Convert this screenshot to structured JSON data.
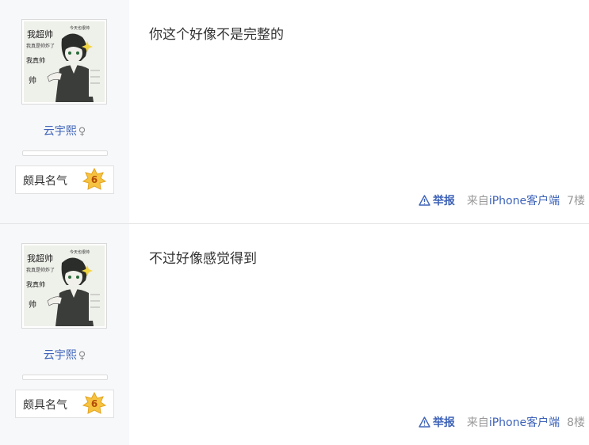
{
  "posts": [
    {
      "author": {
        "name": "云宇熙",
        "gender_symbol": "♀",
        "level_title": "颇具名气",
        "level": "6"
      },
      "content": "你这个好像不是完整的",
      "footer": {
        "report_label": "举报",
        "source_prefix": "来自",
        "client": "iPhone客户端",
        "floor": "7楼"
      }
    },
    {
      "author": {
        "name": "云宇熙",
        "gender_symbol": "♀",
        "level_title": "颇具名气",
        "level": "6"
      },
      "content": "不过好像感觉得到",
      "footer": {
        "report_label": "举报",
        "source_prefix": "来自",
        "client": "iPhone客户端",
        "floor": "8楼"
      }
    }
  ],
  "avatar_text": {
    "big": "我超帅",
    "line1": "我真是帅炸了",
    "side": "我真帅",
    "side2": "帅",
    "top": "今天也很帅"
  },
  "colors": {
    "link": "#3e63b8",
    "badge": "#f6c340",
    "side_bg": "#f7f8fa"
  }
}
